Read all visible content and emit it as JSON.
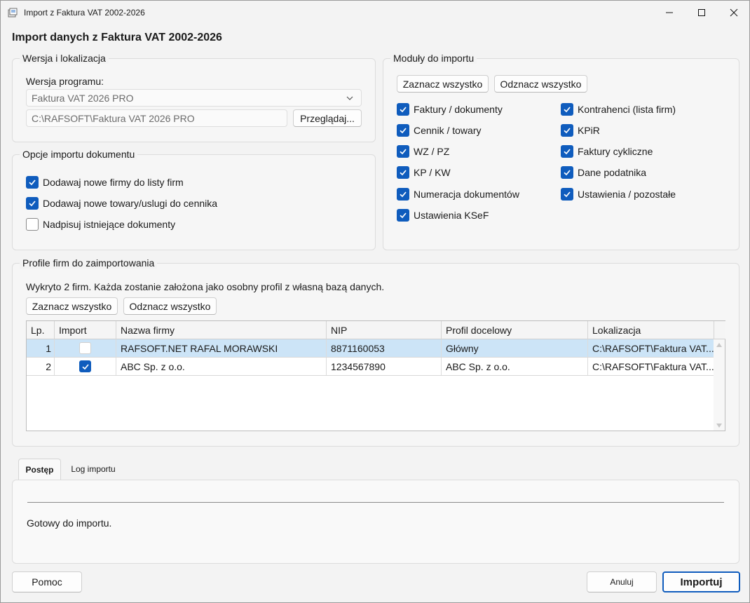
{
  "window": {
    "title": "Import z Faktura VAT 2002-2026",
    "heading": "Import danych z Faktura VAT 2002-2026"
  },
  "version_group": {
    "legend": "Wersja i lokalizacja",
    "version_label": "Wersja programu:",
    "version_selected": "Faktura VAT 2026 PRO",
    "path_value": "C:\\RAFSOFT\\Faktura VAT 2026 PRO",
    "browse_button": "Przeglądaj..."
  },
  "options_group": {
    "legend": "Opcje importu dokumentu",
    "options": [
      {
        "label": "Dodawaj nowe firmy do listy firm",
        "checked": true
      },
      {
        "label": "Dodawaj nowe towary/uslugi do cennika",
        "checked": true
      },
      {
        "label": "Nadpisuj istniejące dokumenty",
        "checked": false
      }
    ]
  },
  "modules_group": {
    "legend": "Moduły do importu",
    "select_all": "Zaznacz wszystko",
    "deselect_all": "Odznacz wszystko",
    "modules": [
      {
        "label": "Faktury / dokumenty",
        "checked": true
      },
      {
        "label": "Kontrahenci (lista firm)",
        "checked": true
      },
      {
        "label": "Cennik / towary",
        "checked": true
      },
      {
        "label": "KPiR",
        "checked": true
      },
      {
        "label": "WZ / PZ",
        "checked": true
      },
      {
        "label": "Faktury cykliczne",
        "checked": true
      },
      {
        "label": "KP / KW",
        "checked": true
      },
      {
        "label": "Dane podatnika",
        "checked": true
      },
      {
        "label": "Numeracja dokumentów",
        "checked": true
      },
      {
        "label": "Ustawienia / pozostałe",
        "checked": true
      },
      {
        "label": "Ustawienia KSeF",
        "checked": true
      }
    ]
  },
  "profiles_group": {
    "legend": "Profile firm do zaimportowania",
    "info": "Wykryto 2 firm. Każda zostanie założona jako osobny profil z własną bazą danych.",
    "select_all": "Zaznacz wszystko",
    "deselect_all": "Odznacz wszystko",
    "columns": [
      "Lp.",
      "Import",
      "Nazwa firmy",
      "NIP",
      "Profil docelowy",
      "Lokalizacja"
    ],
    "rows": [
      {
        "lp": "1",
        "import": false,
        "name": "RAFSOFT.NET RAFAL MORAWSKI",
        "nip": "8871160053",
        "profile": "Główny",
        "location": "C:\\RAFSOFT\\Faktura VAT...",
        "selected": true
      },
      {
        "lp": "2",
        "import": true,
        "name": "ABC Sp. z o.o.",
        "nip": "1234567890",
        "profile": "ABC Sp. z o.o.",
        "location": "C:\\RAFSOFT\\Faktura VAT...",
        "selected": false
      }
    ]
  },
  "tabs": [
    {
      "label": "Postęp",
      "active": true
    },
    {
      "label": "Log importu",
      "active": false
    }
  ],
  "progress": {
    "status": "Gotowy do importu."
  },
  "footer": {
    "help": "Pomoc",
    "cancel": "Anuluj",
    "import": "Importuj"
  },
  "colors": {
    "accent": "#0f5cbd",
    "selected_row": "#cce4f7"
  }
}
